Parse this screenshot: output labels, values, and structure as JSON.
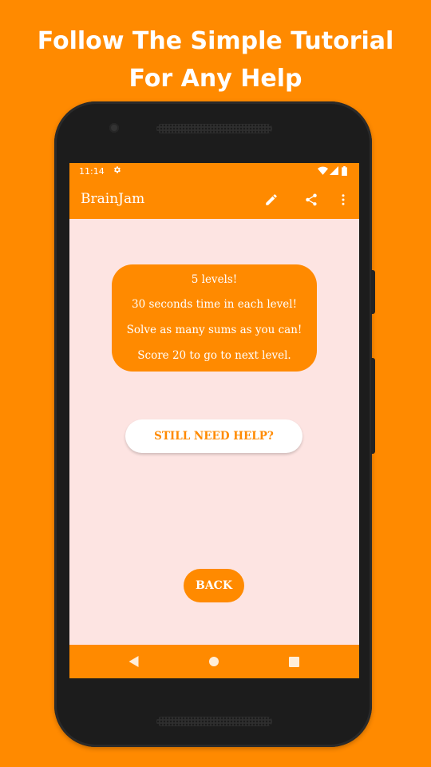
{
  "promo": {
    "line1": "Follow The Simple Tutorial",
    "line2": "For Any Help"
  },
  "status_bar": {
    "time": "11:14",
    "icons": [
      "settings-icon",
      "wifi-icon",
      "signal-icon",
      "battery-icon"
    ]
  },
  "app_bar": {
    "title": "BrainJam",
    "actions": [
      "edit-icon",
      "share-icon",
      "more-vert-icon"
    ]
  },
  "tutorial": {
    "lines": [
      "5 levels!",
      "30 seconds time in each level!",
      "Solve as many sums as you can!",
      "Score 20 to go to next level."
    ]
  },
  "buttons": {
    "help": "STILL NEED HELP?",
    "back": "BACK"
  },
  "nav_bar": {
    "icons": [
      "nav-back-icon",
      "nav-home-icon",
      "nav-recents-icon"
    ]
  },
  "colors": {
    "accent": "#FF8A00",
    "screen_background": "#FDE4E2",
    "text_on_accent": "#FFFFFF"
  }
}
